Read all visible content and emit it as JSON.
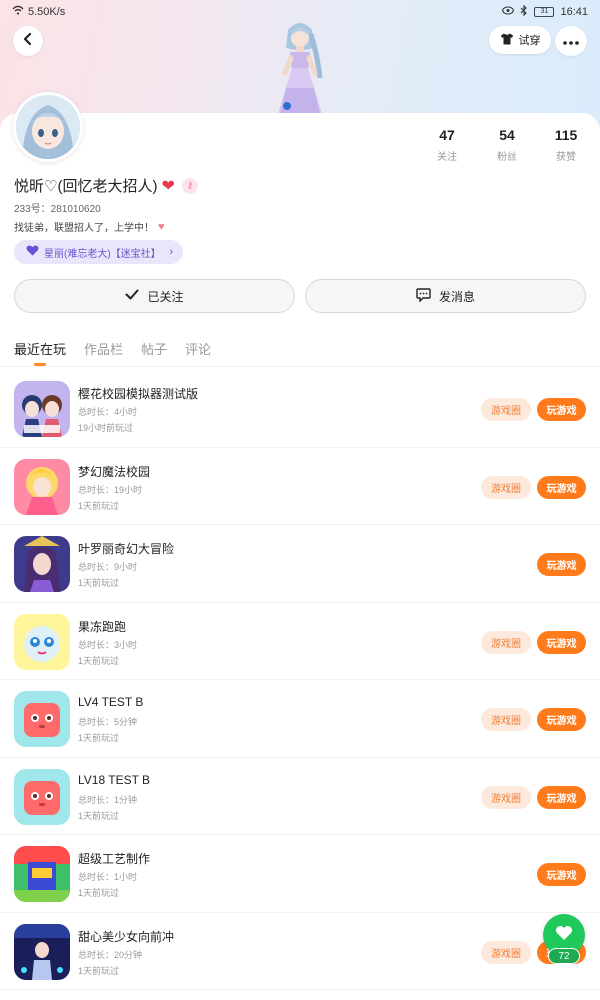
{
  "status_bar": {
    "speed": "5.50K/s",
    "battery": "31",
    "time": "16:41"
  },
  "header": {
    "tryon_label": "试穿"
  },
  "colors": {
    "accent": "#ff7a1a",
    "guild_bg": "#e9e6fb",
    "fab": "#1fc95b"
  },
  "profile": {
    "username": "悦昕♡(回忆老大招人)",
    "uid": "233号：281010620",
    "bio": "找徒弟，联盟招人了，上学中！",
    "guild": "星丽(难忘老大)【迷宝社】",
    "stats": [
      {
        "num": "47",
        "label": "关注"
      },
      {
        "num": "54",
        "label": "粉丝"
      },
      {
        "num": "115",
        "label": "获赞"
      }
    ]
  },
  "actions": {
    "follow": "已关注",
    "message": "发消息"
  },
  "tabs": [
    "最近在玩",
    "作品栏",
    "帖子",
    "评论"
  ],
  "games": [
    {
      "title": "樱花校园模拟器测试版",
      "duration": "总时长：4小时",
      "last": "19小时前玩过",
      "circle": "游戏圈",
      "play": "玩游戏",
      "icon": "sakura-school-game-icon"
    },
    {
      "title": "梦幻魔法校园",
      "duration": "总时长：19小时",
      "last": "1天前玩过",
      "circle": "游戏圈",
      "play": "玩游戏",
      "icon": "magic-school-game-icon"
    },
    {
      "title": "叶罗丽奇幻大冒险",
      "duration": "总时长：9小时",
      "last": "1天前玩过",
      "circle": "",
      "play": "玩游戏",
      "icon": "yeluoli-game-icon"
    },
    {
      "title": "果冻跑跑",
      "duration": "总时长：3小时",
      "last": "1天前玩过",
      "circle": "游戏圈",
      "play": "玩游戏",
      "icon": "jelly-run-game-icon"
    },
    {
      "title": "LV4 TEST B",
      "duration": "总时长：5分钟",
      "last": "1天前玩过",
      "circle": "游戏圈",
      "play": "玩游戏",
      "icon": "lv4-test-game-icon"
    },
    {
      "title": "LV18 TEST B",
      "duration": "总时长：1分钟",
      "last": "1天前玩过",
      "circle": "游戏圈",
      "play": "玩游戏",
      "icon": "lv18-test-game-icon"
    },
    {
      "title": "超级工艺制作",
      "duration": "总时长：1小时",
      "last": "1天前玩过",
      "circle": "",
      "play": "玩游戏",
      "icon": "super-craft-game-icon"
    },
    {
      "title": "甜心美少女向前冲",
      "duration": "总时长：20分钟",
      "last": "1天前玩过",
      "circle": "游戏圈",
      "play": "玩游戏",
      "icon": "sweet-girl-run-game-icon"
    }
  ],
  "fab": {
    "count": "72"
  }
}
